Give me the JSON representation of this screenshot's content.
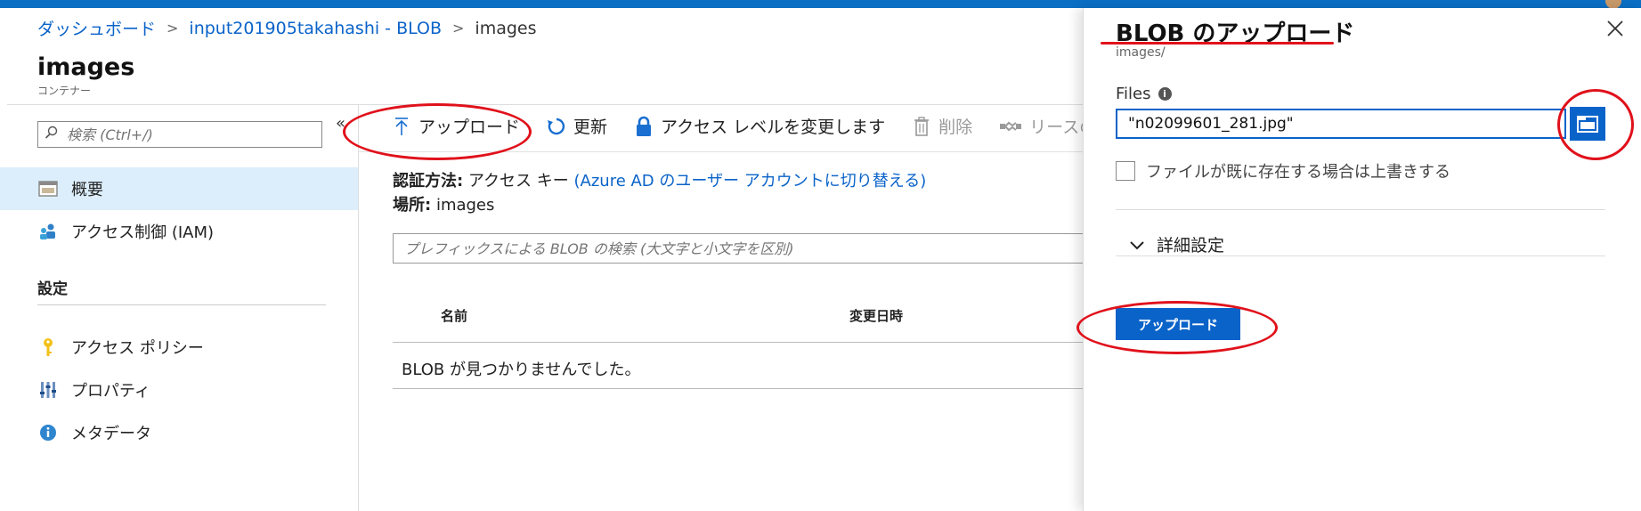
{
  "breadcrumb": {
    "dashboard": "ダッシュボード",
    "storage": "input201905takahashi - BLOB",
    "current": "images",
    "separator": ">"
  },
  "page": {
    "title": "images",
    "subtitle": "コンテナー"
  },
  "sidebar": {
    "search_placeholder": "検索 (Ctrl+/)",
    "collapse": "«",
    "items": [
      {
        "label": "概要",
        "icon": "overview-icon",
        "active": true
      },
      {
        "label": "アクセス制御 (IAM)",
        "icon": "iam-icon",
        "active": false
      }
    ],
    "section_label": "設定",
    "settings_items": [
      {
        "label": "アクセス ポリシー",
        "icon": "key-icon"
      },
      {
        "label": "プロパティ",
        "icon": "properties-icon"
      },
      {
        "label": "メタデータ",
        "icon": "info-icon"
      }
    ]
  },
  "toolbar": {
    "upload": "アップロード",
    "refresh": "更新",
    "change_access": "アクセス レベルを変更します",
    "delete": "削除",
    "lease": "リースの取得"
  },
  "main": {
    "auth_label": "認証方法:",
    "auth_value": "アクセス キー",
    "auth_link": "(Azure AD のユーザー アカウントに切り替える)",
    "location_label": "場所:",
    "location_value": "images",
    "blob_search_placeholder": "プレフィックスによる BLOB の検索 (大文字と小文字を区別)",
    "columns": [
      "名前",
      "変更日時"
    ],
    "empty_message": "BLOB が見つかりませんでした。"
  },
  "blade": {
    "title": "BLOB のアップロード",
    "subtitle": "images/",
    "files_label": "Files",
    "file_value": "\"n02099601_281.jpg\"",
    "overwrite_label": "ファイルが既に存在する場合は上書きする",
    "advanced_label": "詳細設定",
    "upload_button": "アップロード"
  },
  "colors": {
    "accent": "#0a63c9",
    "annotation": "#e0111b",
    "active_nav": "#dceefb"
  }
}
